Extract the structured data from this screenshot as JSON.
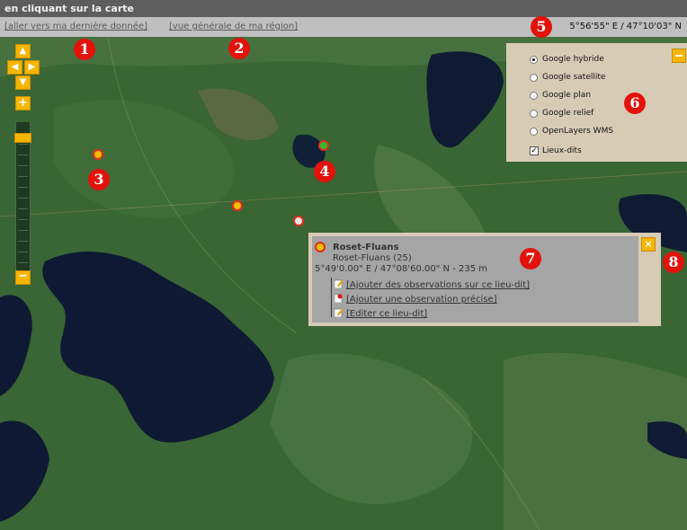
{
  "header": {
    "title": "en cliquant sur la carte"
  },
  "linkbar": {
    "link_last_data": "[aller vers ma dernière donnée]",
    "link_region_overview": "[vue générale de ma région]",
    "coordinates": "5°56'55\" E / 47°10'03\" N"
  },
  "annotations": [
    "1",
    "2",
    "3",
    "4",
    "5",
    "6",
    "7",
    "8"
  ],
  "map_controls": {
    "pan_up_icon": "arrow-up-icon",
    "pan_left_icon": "arrow-left-icon",
    "pan_right_icon": "arrow-right-icon",
    "pan_down_icon": "arrow-down-icon",
    "zoom_in_icon": "plus-icon",
    "zoom_out_icon": "minus-icon"
  },
  "markers": [
    {
      "id": "marker-1",
      "fill": "#f6c000"
    },
    {
      "id": "marker-2",
      "fill": "#2dbf2d"
    },
    {
      "id": "marker-3",
      "fill": "#f6c000"
    },
    {
      "id": "marker-4",
      "fill": "#e6e6e6"
    }
  ],
  "layers": {
    "options": [
      {
        "label": "Google hybride",
        "selected": true
      },
      {
        "label": "Google satellite",
        "selected": false
      },
      {
        "label": "Google plan",
        "selected": false
      },
      {
        "label": "Google relief",
        "selected": false
      },
      {
        "label": "OpenLayers WMS",
        "selected": false
      }
    ],
    "overlay_label": "Lieux-dits",
    "overlay_checked": true
  },
  "popup": {
    "title": "Roset-Fluans",
    "subtitle": "Roset-Fluans (25)",
    "coordinates": "5°49'0.00\" E / 47°08'60.00\" N - 235 m",
    "links": [
      {
        "label": "[Ajouter des observations sur ce lieu-dit]",
        "icon": "edit-icon"
      },
      {
        "label": "[Ajouter une observation précise]",
        "icon": "pin-icon"
      },
      {
        "label": "[Editer ce lieu-dit]",
        "icon": "edit-icon"
      }
    ],
    "close_icon": "close-icon"
  },
  "colors": {
    "accent": "#f6b500",
    "annotation_red": "#e3120b",
    "panel_bg": "#d8cbb6"
  }
}
